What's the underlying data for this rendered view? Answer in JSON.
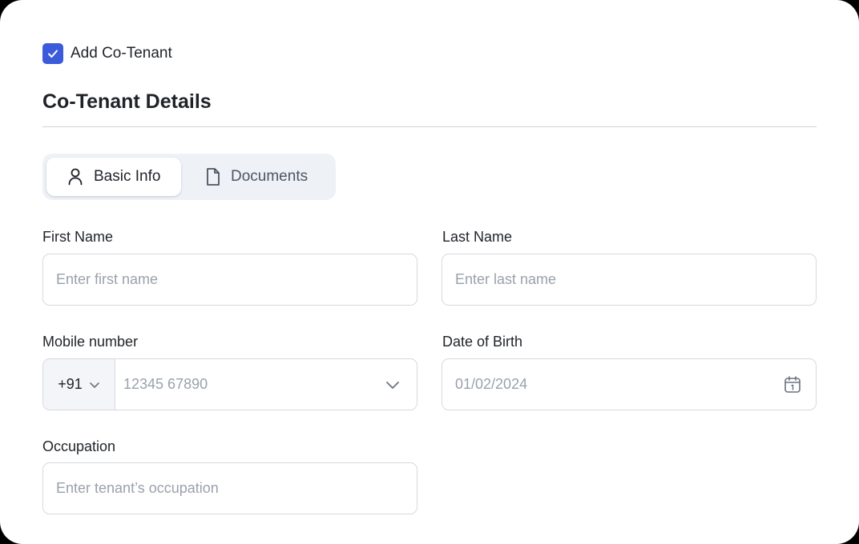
{
  "checkbox": {
    "label": "Add Co-Tenant",
    "checked": true
  },
  "section": {
    "title": "Co-Tenant Details"
  },
  "tabs": [
    {
      "label": "Basic Info",
      "icon": "user-icon",
      "active": true
    },
    {
      "label": "Documents",
      "icon": "document-icon",
      "active": false
    }
  ],
  "form": {
    "first_name": {
      "label": "First Name",
      "placeholder": "Enter first name"
    },
    "last_name": {
      "label": "Last Name",
      "placeholder": "Enter last name"
    },
    "mobile": {
      "label": "Mobile number",
      "country_code": "+91",
      "placeholder": "12345 67890"
    },
    "dob": {
      "label": "Date of Birth",
      "value": "01/02/2024",
      "icon": "calendar-icon"
    },
    "occupation": {
      "label": "Occupation",
      "placeholder": "Enter tenant’s occupation"
    }
  },
  "colors": {
    "accent": "#3b5bdb",
    "border": "#d5d9df",
    "placeholder": "#9aa1ab"
  }
}
